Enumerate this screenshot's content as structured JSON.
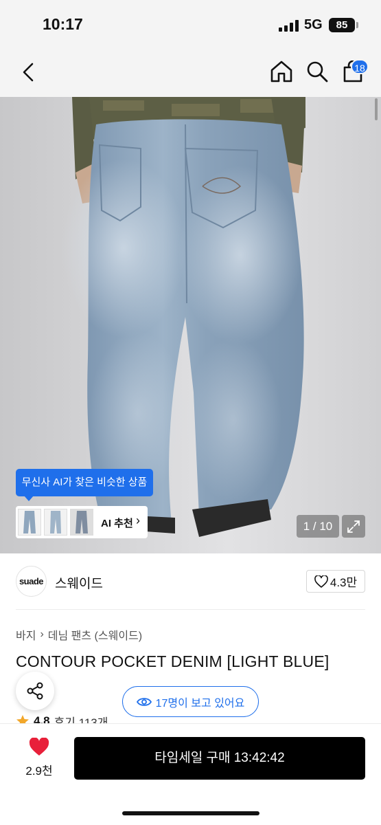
{
  "status_bar": {
    "time": "10:17",
    "network": "5G",
    "battery": "85"
  },
  "nav": {
    "back_icon": "chevron-left-icon",
    "home_icon": "home-icon",
    "search_icon": "search-icon",
    "cart_icon": "shopping-bag-icon",
    "cart_badge": "18"
  },
  "product_image": {
    "alt": "light blue wide-leg denim jeans, back view",
    "counter": "1 / 10",
    "ai_tooltip": "무신사 AI가 찾은 비슷한 상품",
    "ai_recommend_label": "AI 추천",
    "ai_chevron": "›"
  },
  "brand": {
    "logo_text": "suade",
    "name": "스웨이드",
    "likes": "4.3만"
  },
  "breadcrumb": [
    "바지",
    "데님 팬츠 (스웨이드)"
  ],
  "product": {
    "title": "CONTOUR POCKET DENIM [LIGHT BLUE]",
    "rating": "4.8",
    "reviews": "후기 113개"
  },
  "floating": {
    "viewers": "17명이 보고 있어요"
  },
  "bottom_bar": {
    "wishlist_count": "2.9천",
    "buy_label": "타임세일 구매 13:42:42"
  },
  "colors": {
    "accent": "#1f6feb",
    "heart": "#e8203a",
    "buy_button": "#000000",
    "denim": "#8fa6bd"
  }
}
